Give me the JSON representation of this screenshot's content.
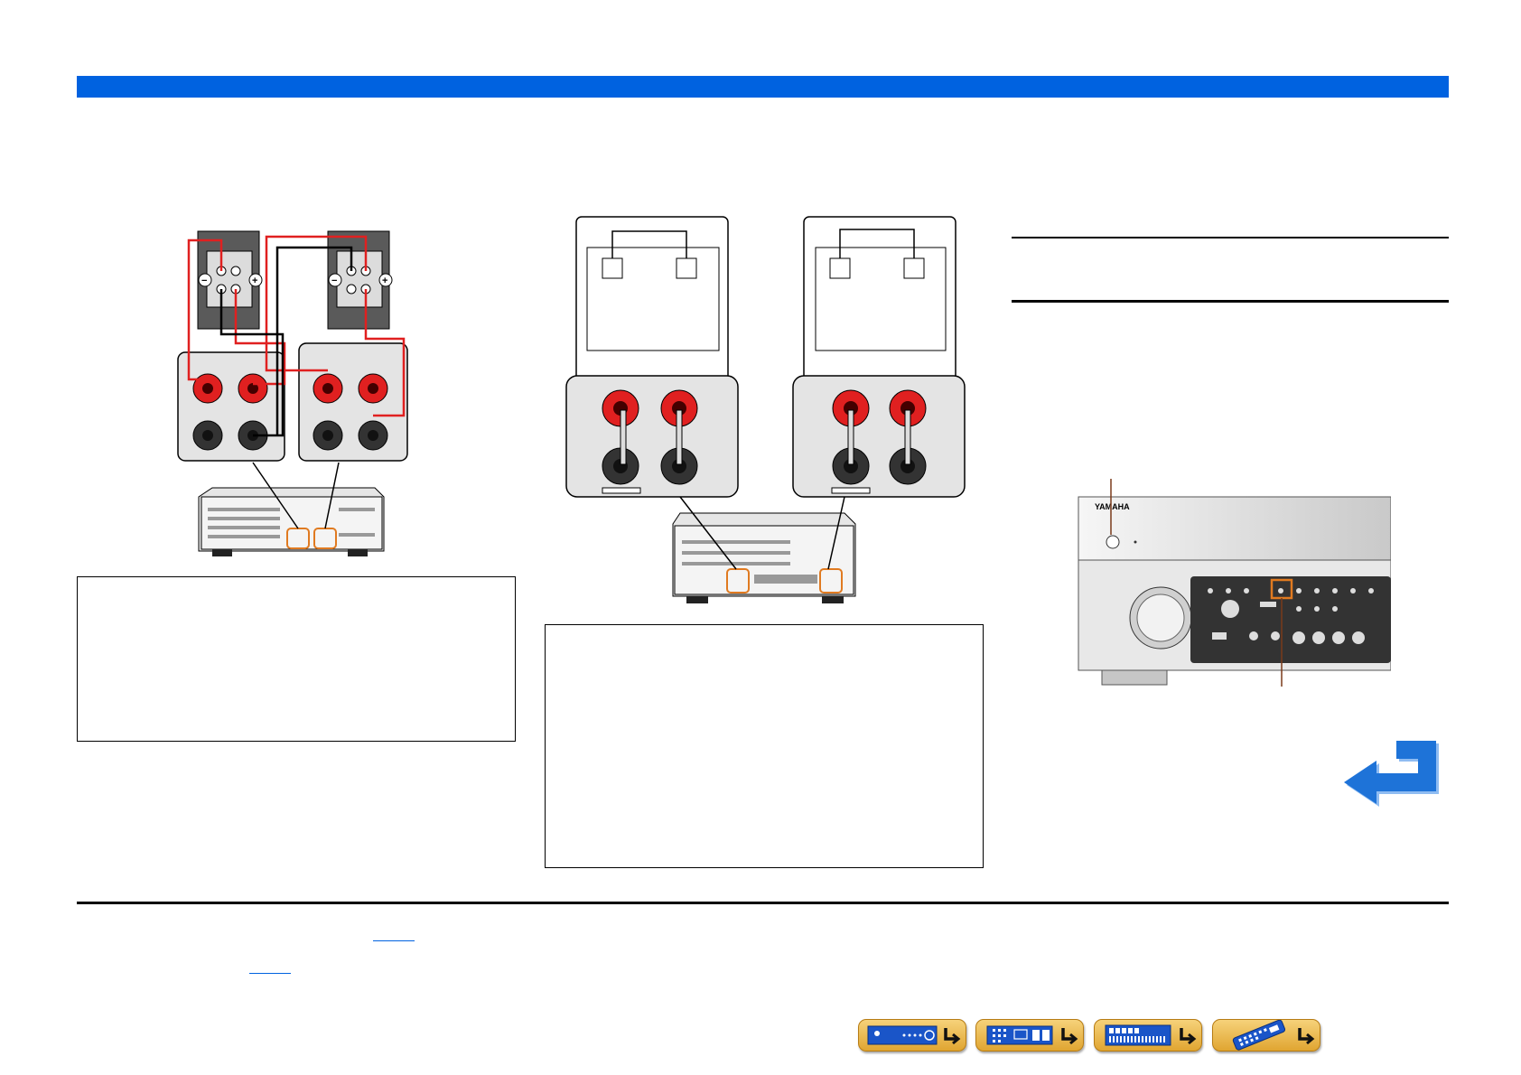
{
  "device": {
    "brand": "YAMAHA"
  },
  "theme": {
    "header_bar_color": "#0062e0",
    "wire_red": "#e02020",
    "highlight_orange": "#e07a20",
    "return_arrow_color": "#1e73d8",
    "nav_button_color": "#f0c25a"
  },
  "figures": {
    "bi_amp_connection": "speaker-bi-amp-diagram",
    "bi_wire_connection": "speaker-bi-wire-diagram",
    "front_panel": "receiver-front-panel"
  },
  "navigation": {
    "buttons": [
      {
        "icon": "front-panel-icon"
      },
      {
        "icon": "rear-panel-icon"
      },
      {
        "icon": "front-display-icon"
      },
      {
        "icon": "remote-control-icon"
      }
    ],
    "return_icon": "return-arrow-icon"
  }
}
